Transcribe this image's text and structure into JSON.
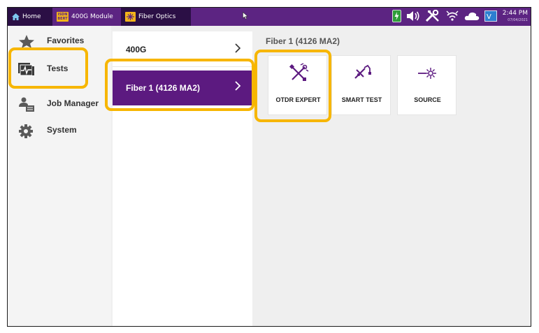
{
  "topbar": {
    "home_label": "Home",
    "module_badge_line1": "ISDN",
    "module_badge_line2": "BERT",
    "module_label": "400G Module",
    "fiber_label": "Fiber Optics",
    "time": "2:44 PM",
    "date": "07/04/2021",
    "vnc_label": "V",
    "status_icons": [
      "battery-charging-icon",
      "speaker-icon",
      "tools-icon",
      "wifi-scan-icon",
      "cloud-icon",
      "vnc-icon"
    ]
  },
  "sidebar": {
    "items": [
      {
        "label": "Favorites",
        "icon": "star-icon"
      },
      {
        "label": "Tests",
        "icon": "tests-icon"
      },
      {
        "label": "Job Manager",
        "icon": "job-manager-icon"
      },
      {
        "label": "System",
        "icon": "gear-icon"
      }
    ]
  },
  "middle": {
    "items": [
      {
        "label": "400G"
      },
      {
        "label": "Fiber 1 (4126 MA2)"
      }
    ]
  },
  "content": {
    "title": "Fiber 1 (4126 MA2)",
    "tiles": [
      {
        "label": "OTDR EXPERT",
        "icon": "otdr-expert-icon"
      },
      {
        "label": "SMART TEST",
        "icon": "smart-test-icon"
      },
      {
        "label": "SOURCE",
        "icon": "source-icon"
      }
    ]
  },
  "colors": {
    "topbar": "#5c2482",
    "topbar_dark": "#2b0f45",
    "selected": "#5c1a80",
    "highlight": "#f7b600",
    "accent_yellow": "#f3b519"
  }
}
